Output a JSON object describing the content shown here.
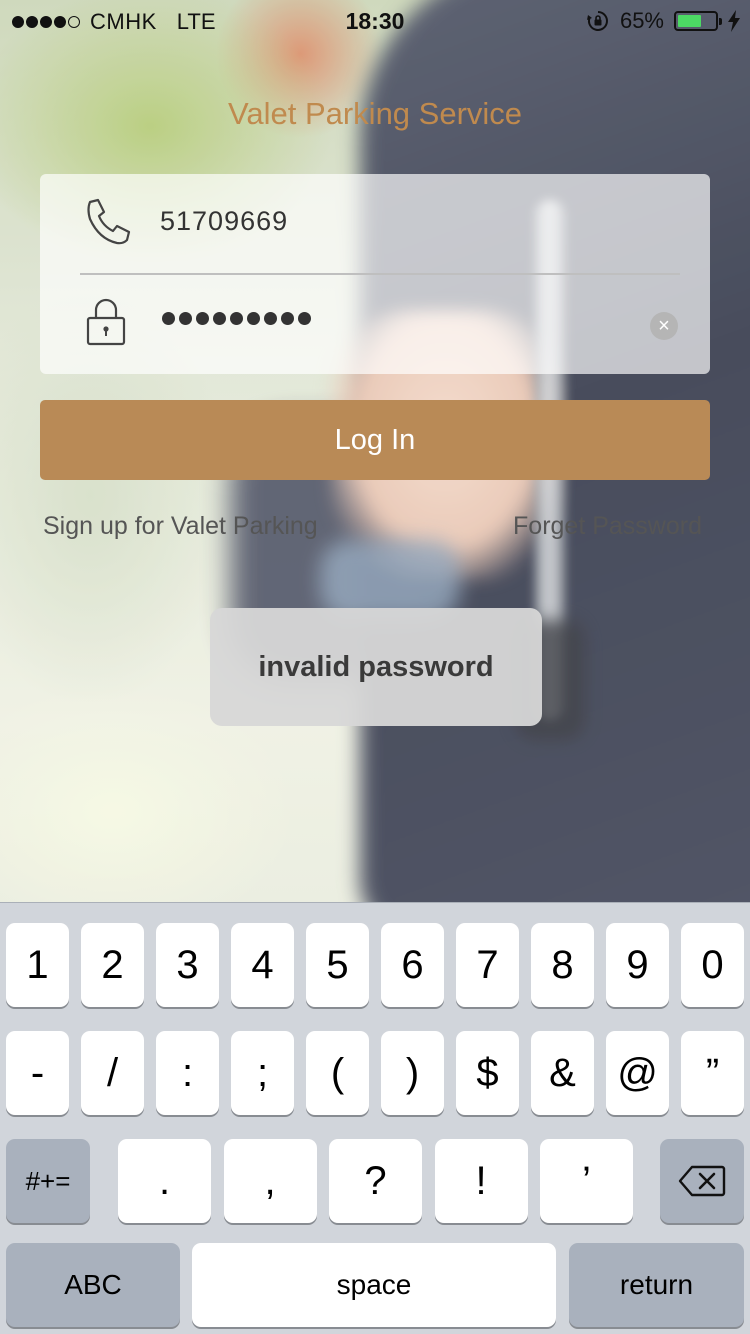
{
  "status_bar": {
    "carrier": "CMHK",
    "network": "LTE",
    "time": "18:30",
    "battery_percent": "65%",
    "battery_level": 0.65,
    "signal_bars": 4,
    "icons": [
      "rotation-lock-icon",
      "charging-bolt-icon"
    ]
  },
  "app": {
    "title": "Valet Parking Service",
    "accent_color": "#b98a56"
  },
  "form": {
    "phone_icon": "phone-icon",
    "phone_value": "51709669",
    "lock_icon": "lock-icon",
    "password_mask_length": 9,
    "clear_icon": "clear-icon"
  },
  "actions": {
    "login_label": "Log In",
    "signup_label": "Sign up for Valet Parking",
    "forget_label": "Forget Password"
  },
  "toast": {
    "message": "invalid password"
  },
  "keyboard": {
    "row1": [
      "1",
      "2",
      "3",
      "4",
      "5",
      "6",
      "7",
      "8",
      "9",
      "0"
    ],
    "row2": [
      "-",
      "/",
      ":",
      ";",
      "(",
      ")",
      "$",
      "&",
      "@",
      "”"
    ],
    "row3_mode": "#+=",
    "row3": [
      ".",
      ",",
      "?",
      "!",
      "’"
    ],
    "delete_icon": "backspace-icon",
    "abc_label": "ABC",
    "space_label": "space",
    "return_label": "return"
  }
}
